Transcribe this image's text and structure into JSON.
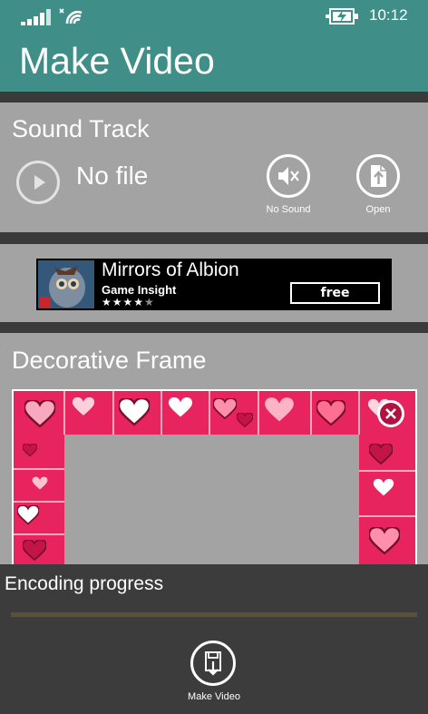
{
  "status_bar": {
    "time": "10:12",
    "icons": [
      "signal-icon",
      "wifi-icon",
      "battery-charging-icon"
    ]
  },
  "app": {
    "title": "Make Video"
  },
  "sound_track": {
    "title": "Sound Track",
    "file_label": "No file",
    "no_sound_label": "No Sound",
    "open_label": "Open",
    "icons": [
      "play-icon",
      "mute-icon",
      "open-file-icon"
    ]
  },
  "ad": {
    "name": "Mirrors of Albion",
    "publisher": "Game Insight",
    "stars": "★★★★",
    "rating": 4.5,
    "button_label": "free"
  },
  "frame": {
    "title": "Decorative Frame",
    "icons": [
      "heart-icon",
      "close-icon"
    ]
  },
  "encoding": {
    "label": "Encoding progress",
    "progress": 0
  },
  "app_bar": {
    "make_video_label": "Make Video",
    "icons": [
      "save-video-icon"
    ]
  },
  "colors": {
    "accent": "#3f8f88",
    "panel": "#a3a3a3",
    "background": "#3a3a3a",
    "frame_pink": "#e8245e"
  }
}
